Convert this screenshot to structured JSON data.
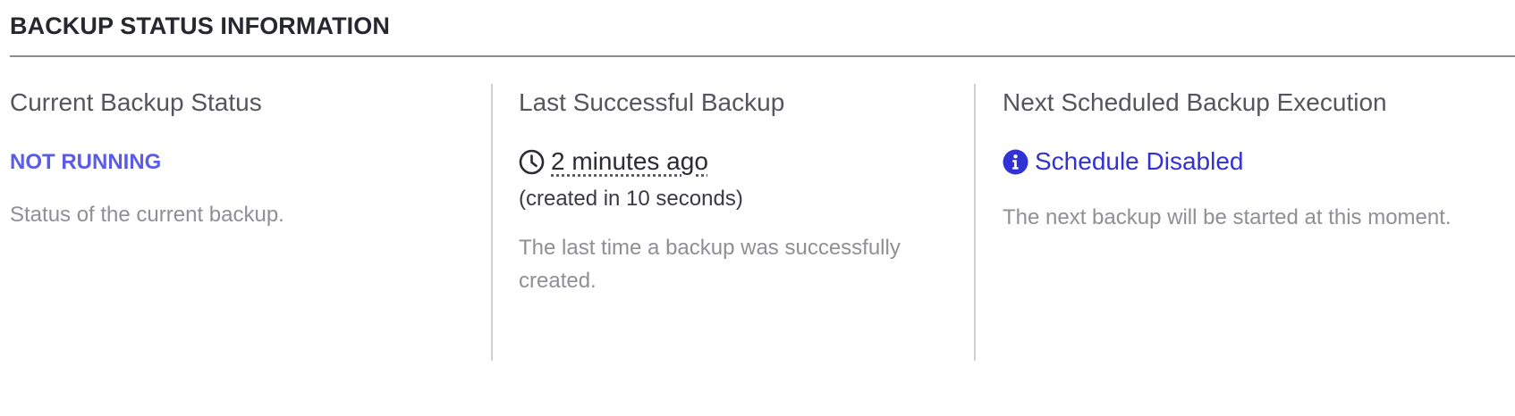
{
  "section": {
    "title": "BACKUP STATUS INFORMATION"
  },
  "current_status": {
    "heading": "Current Backup Status",
    "value": "NOT RUNNING",
    "description": "Status of the current backup.",
    "value_color": "#5b5bea"
  },
  "last_backup": {
    "heading": "Last Successful Backup",
    "icon": "clock-icon",
    "time_ago": "2 minutes ago",
    "duration": "(created in 10 seconds)",
    "description": "The last time a backup was successfully created."
  },
  "next_backup": {
    "heading": "Next Scheduled Backup Execution",
    "icon": "info-circle-icon",
    "value": "Schedule Disabled",
    "description": "The next backup will be started at this moment.",
    "value_color": "#3232d4"
  }
}
